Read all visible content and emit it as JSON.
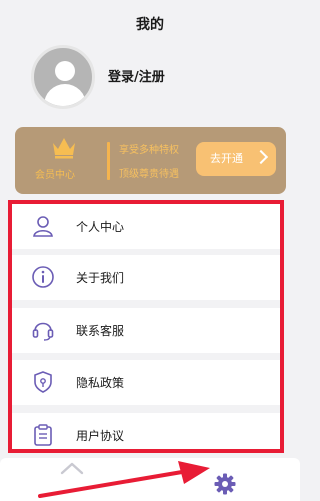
{
  "header": {
    "title": "我的"
  },
  "profile": {
    "login_label": "登录/注册"
  },
  "vip": {
    "label": "会员中心",
    "line1": "享受多种特权",
    "line2": "顶级尊贵待遇",
    "button_label": "去开通",
    "accent_color": "#f6bd52"
  },
  "menu": {
    "items": [
      {
        "label": "个人中心",
        "icon": "person-icon"
      },
      {
        "label": "关于我们",
        "icon": "info-icon"
      },
      {
        "label": "联系客服",
        "icon": "headset-icon"
      },
      {
        "label": "隐私政策",
        "icon": "shield-icon"
      },
      {
        "label": "用户协议",
        "icon": "clipboard-icon"
      }
    ],
    "highlight_color": "#e81c35",
    "icon_color": "#6b5db5"
  },
  "tabbar": {
    "icons": [
      "home-icon",
      "settings-gear-icon"
    ]
  }
}
